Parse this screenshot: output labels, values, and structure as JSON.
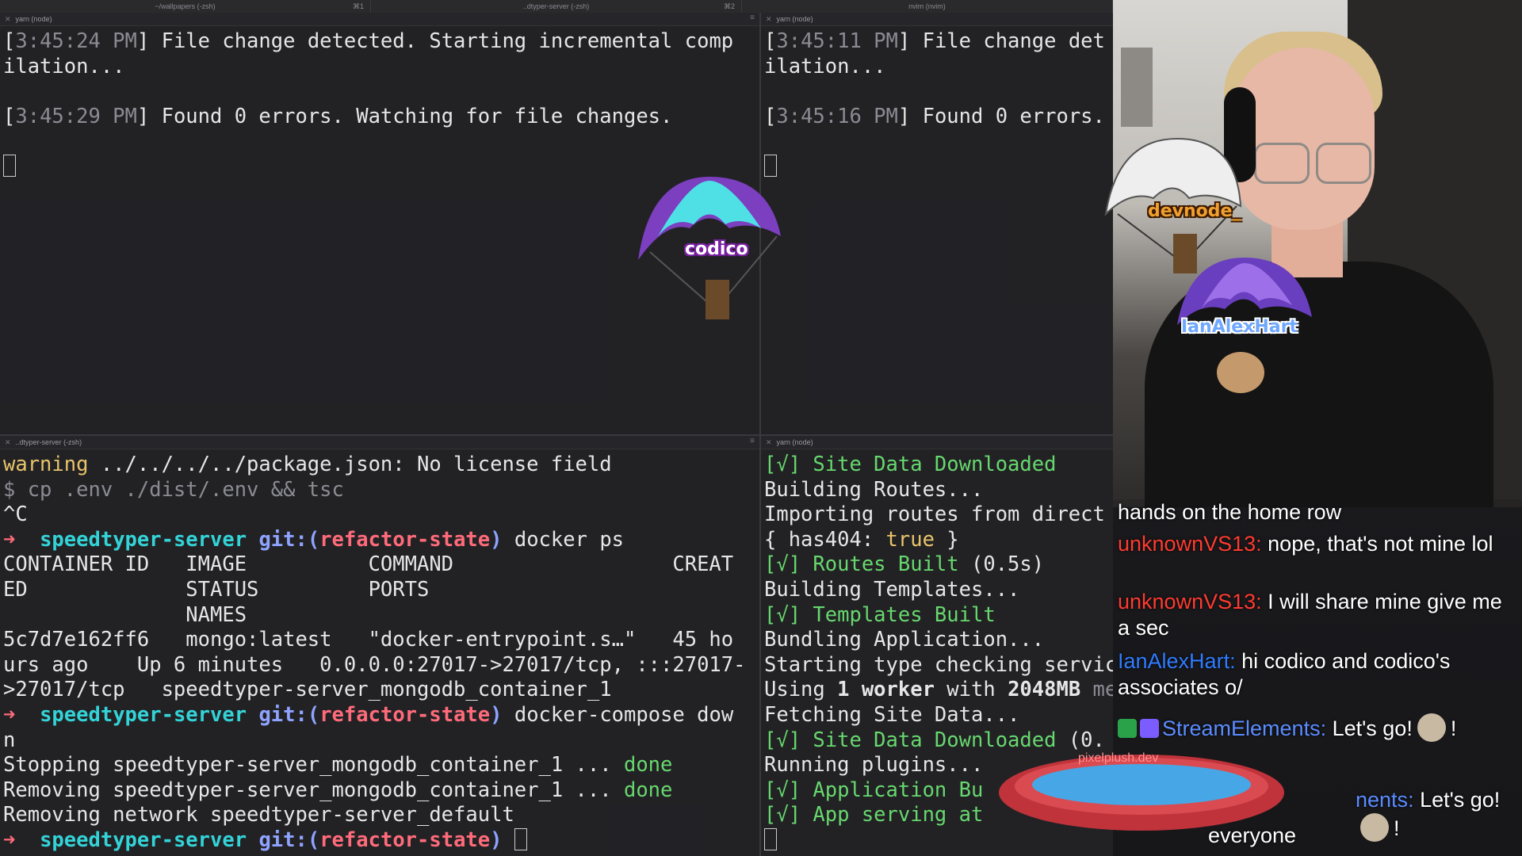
{
  "tabs": [
    {
      "label": "~/wallpapers (-zsh)",
      "kbd": "⌘1"
    },
    {
      "label": "..dtyper-server (-zsh)",
      "kbd": "⌘2"
    },
    {
      "label": "nvim (nvim)",
      "kbd": ""
    }
  ],
  "panes": {
    "top_left": {
      "title": "yarn (node)",
      "lines": [
        [
          "[",
          "3:45:24 PM",
          "] File change detected. Starting incremental comp"
        ],
        [
          "ilation..."
        ],
        [
          ""
        ],
        [
          "[",
          "3:45:29 PM",
          "] Found 0 errors. Watching for file changes."
        ]
      ]
    },
    "top_right": {
      "title": "yarn (node)",
      "lines": [
        [
          "[",
          "3:45:11 PM",
          "] File change det"
        ],
        [
          "ilation..."
        ],
        [
          ""
        ],
        [
          "[",
          "3:45:16 PM",
          "] Found 0 errors."
        ]
      ]
    },
    "bottom_left": {
      "title": "..dtyper-server (-zsh)",
      "warning_word": "warning",
      "warning_rest": " ../../../../package.json: No license field",
      "cmd1": "$ cp .env ./dist/.env && tsc",
      "ctrl_c": "^C",
      "arrow": "➜",
      "dir": "speedtyper-server",
      "git": "git:(",
      "branch": "refactor-state",
      "git_close": ")",
      "cmd_docker_ps": " docker ps",
      "table_lines": [
        "CONTAINER ID   IMAGE          COMMAND                  CREAT",
        "ED             STATUS         PORTS",
        "               NAMES",
        "5c7d7e162ff6   mongo:latest   \"docker-entrypoint.s…\"   45 ho",
        "urs ago    Up 6 minutes   0.0.0.0:27017->27017/tcp, :::27017-",
        ">27017/tcp   speedtyper-server_mongodb_container_1"
      ],
      "cmd_compose": " docker-compose dow",
      "compose_wrap": "n",
      "stop_line": "Stopping speedtyper-server_mongodb_container_1 ... ",
      "remove_line": "Removing speedtyper-server_mongodb_container_1 ... ",
      "done": "done",
      "network_line": "Removing network speedtyper-server_default"
    },
    "bottom_right": {
      "title": "yarn (node)",
      "l1": "[√] Site Data Downloaded",
      "l2": "Building Routes...",
      "l3": "Importing routes from direct",
      "l4a": "{ has404: ",
      "l4b": "true",
      "l4c": " }",
      "l5a": "[√] Routes Built",
      "l5b": " (0.5s)",
      "l6": "Building Templates...",
      "l7": "[√] Templates Built",
      "l8": "Bundling Application...",
      "l9": "Starting type checking servic",
      "l10a": "Using ",
      "l10b": "1 worker",
      "l10c": " with ",
      "l10d": "2048MB",
      "l10e": " memory limit",
      "l11": "Fetching Site Data...",
      "l12a": "[√] Site Data Downloaded",
      "l12b": " (0.",
      "l13": "Running plugins...",
      "l14": "[√] Application Bu",
      "l15": "[√] App serving at"
    }
  },
  "overlay_names": {
    "codico": "codico",
    "devnode": "devnode_",
    "ian": "IanAlexHart"
  },
  "pool_label": "pixelplush.dev",
  "chat": {
    "messages": [
      {
        "user": "",
        "text": "hands on the home row"
      },
      {
        "user": "unknownVS13",
        "sep": ":",
        "text": " nope, that's not mine lol"
      },
      {
        "user": "unknownVS13",
        "sep": ":",
        "text": " I will share mine give me a sec"
      },
      {
        "user": "IanAlexHart",
        "sep": ":",
        "text": " hi codico and codico's associates o/"
      },
      {
        "user": "StreamElements",
        "sep": ":",
        "text": " Let's go!",
        "tail": "!"
      },
      {
        "user": "nents",
        "sep": ":",
        "text": " Let's go!",
        "tail": "!"
      },
      {
        "user": "",
        "text": "everyone"
      }
    ]
  },
  "colors": {
    "accent_cyan": "#33d3d7",
    "branch_red": "#ff6b7a",
    "chat_red": "#ff3b30",
    "chat_blue": "#2f7bff"
  }
}
